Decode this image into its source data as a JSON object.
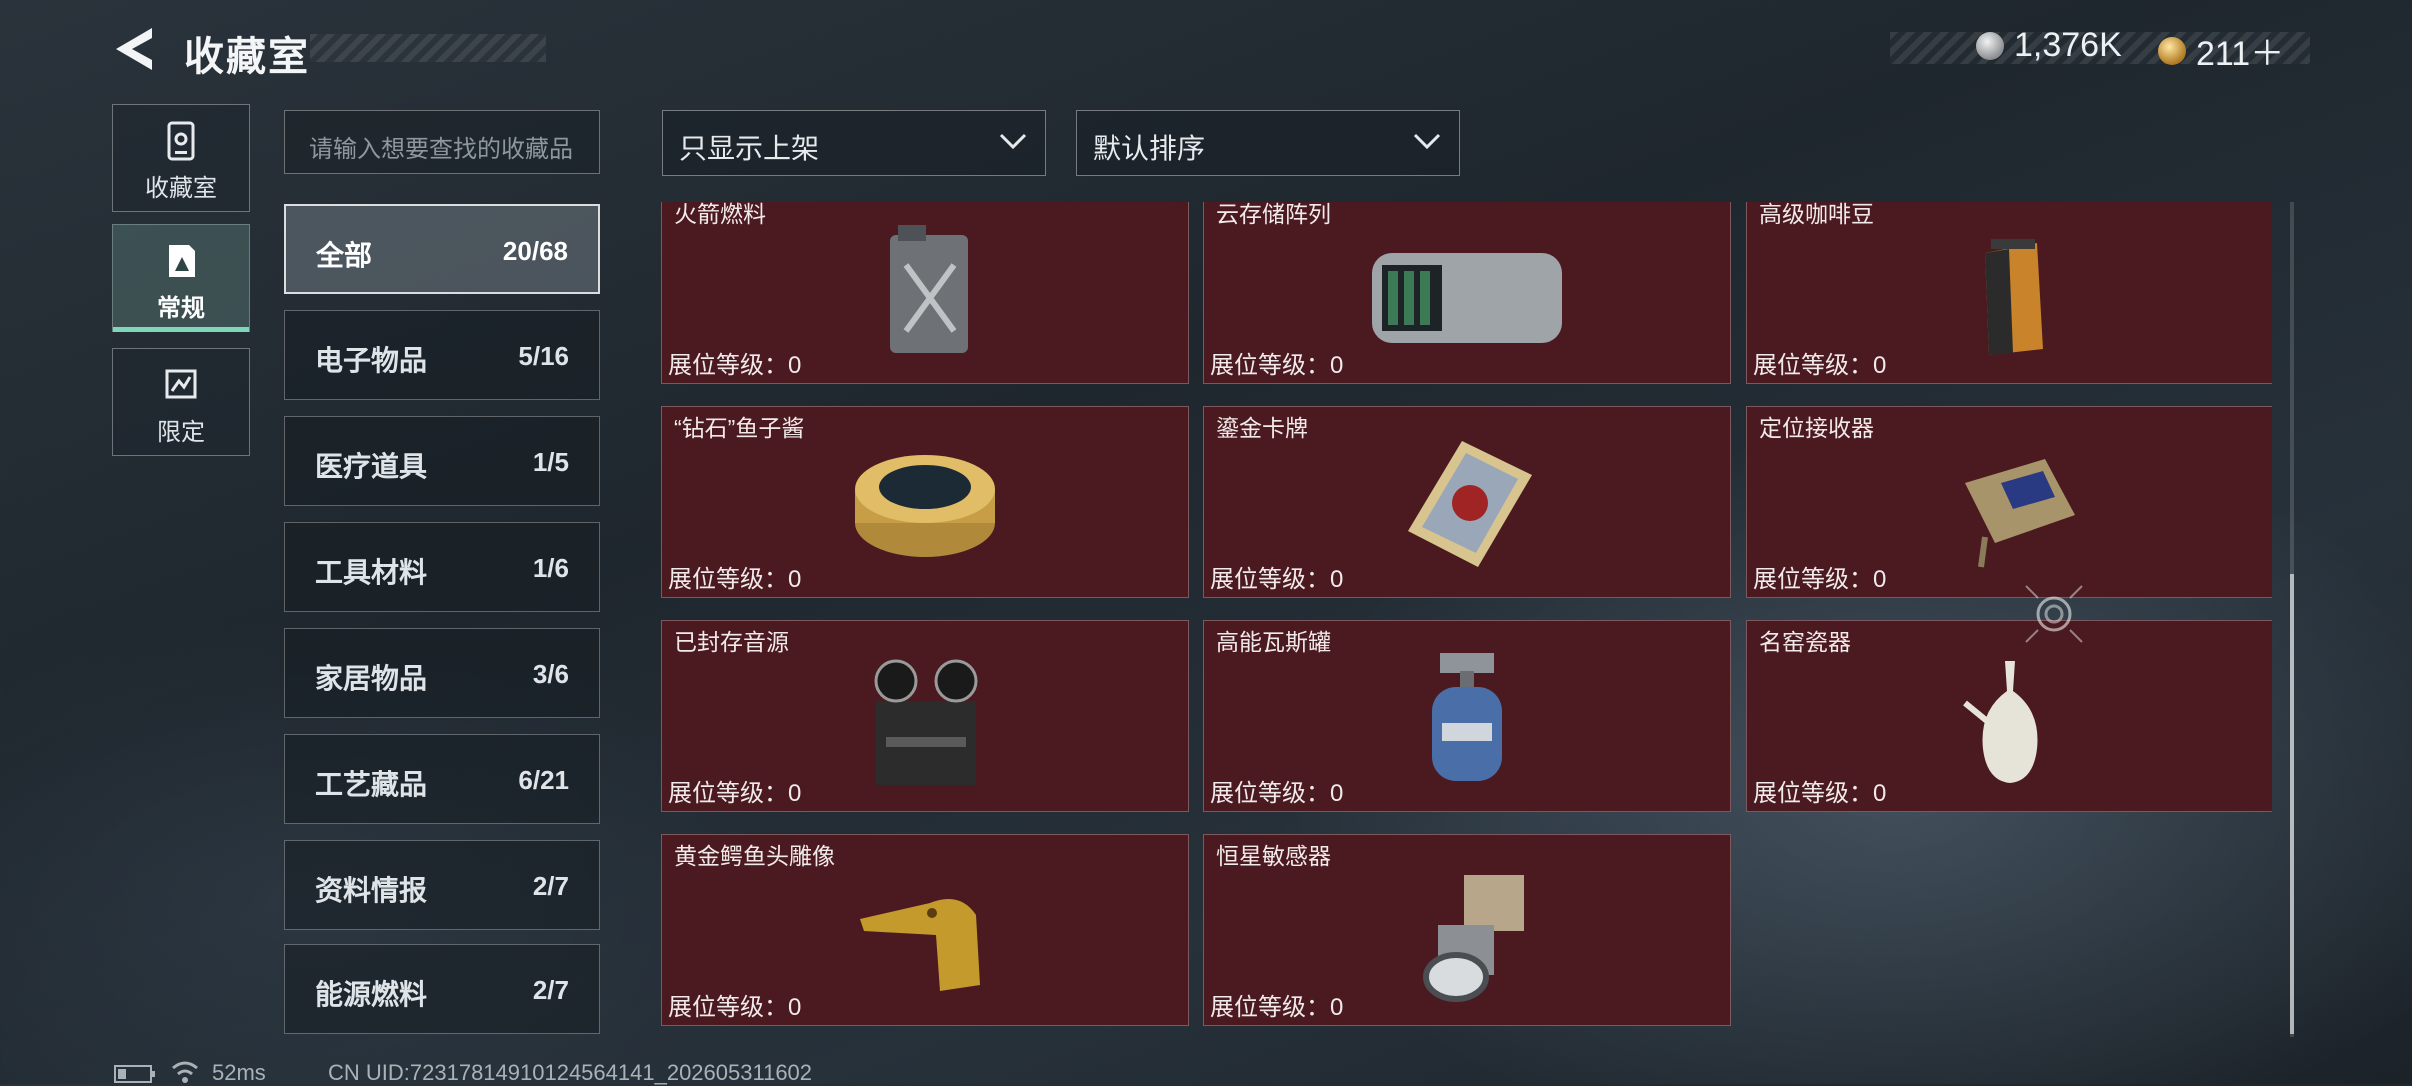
{
  "header": {
    "title": "收藏室",
    "currency_a": "1,376K",
    "currency_b": "211＋"
  },
  "rail": [
    {
      "label": "收藏室",
      "icon": "cabinet-icon"
    },
    {
      "label": "常规",
      "icon": "photo-frame-icon"
    },
    {
      "label": "限定",
      "icon": "limited-badge-icon"
    }
  ],
  "search": {
    "placeholder": "请输入想要查找的收藏品"
  },
  "filters": {
    "display": "只显示上架",
    "sort": "默认排序"
  },
  "categories": [
    {
      "name": "全部",
      "count": "20/68"
    },
    {
      "name": "电子物品",
      "count": "5/16"
    },
    {
      "name": "医疗道具",
      "count": "1/5"
    },
    {
      "name": "工具材料",
      "count": "1/6"
    },
    {
      "name": "家居物品",
      "count": "3/6"
    },
    {
      "name": "工艺藏品",
      "count": "6/21"
    },
    {
      "name": "资料情报",
      "count": "2/7"
    },
    {
      "name": "能源燃料",
      "count": "2/7"
    }
  ],
  "items": [
    {
      "name": "火箭燃料",
      "level": "展位等级：0",
      "icon": "fuel-can-icon"
    },
    {
      "name": "云存储阵列",
      "level": "展位等级：0",
      "icon": "server-array-icon"
    },
    {
      "name": "高级咖啡豆",
      "level": "展位等级：0",
      "icon": "coffee-bag-icon"
    },
    {
      "name": "“钻石”鱼子酱",
      "level": "展位等级：0",
      "icon": "caviar-tin-icon"
    },
    {
      "name": "鎏金卡牌",
      "level": "展位等级：0",
      "icon": "gilded-card-icon"
    },
    {
      "name": "定位接收器",
      "level": "展位等级：0",
      "icon": "receiver-icon"
    },
    {
      "name": "已封存音源",
      "level": "展位等级：0",
      "icon": "tape-recorder-icon"
    },
    {
      "name": "高能瓦斯罐",
      "level": "展位等级：0",
      "icon": "gas-tank-icon"
    },
    {
      "name": "名窑瓷器",
      "level": "展位等级：0",
      "icon": "porcelain-ewer-icon"
    },
    {
      "name": "黄金鳄鱼头雕像",
      "level": "展位等级：0",
      "icon": "gold-crocodile-icon"
    },
    {
      "name": "恒星敏感器",
      "level": "展位等级：0",
      "icon": "star-sensor-icon"
    }
  ],
  "status": {
    "ping": "52ms",
    "uid": "CN UID:723178149101245641​41_202605311602"
  }
}
